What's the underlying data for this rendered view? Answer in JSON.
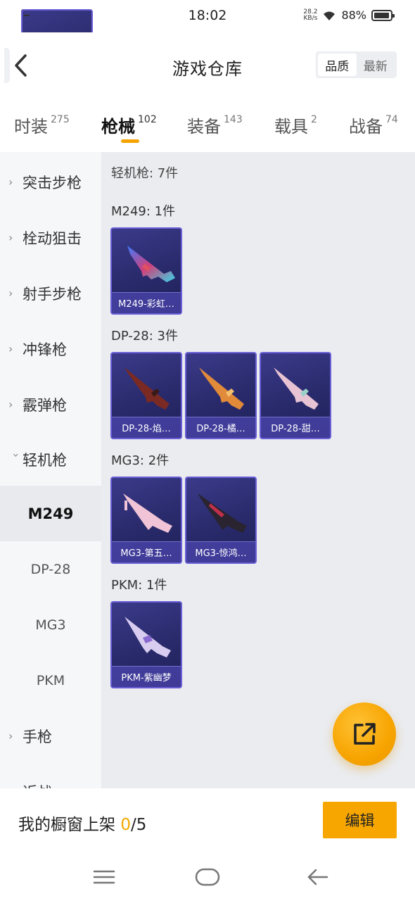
{
  "status_bar": {
    "time": "18:02",
    "net_speed_value": "28.2",
    "net_speed_unit": "KB/s",
    "battery": "88%",
    "icons": [
      "notification-x-icon",
      "app-red-icon",
      "sd-card-icon",
      "wifi-icon",
      "battery-icon"
    ]
  },
  "header": {
    "title": "游戏仓库",
    "back_icon": "back-arrow-icon",
    "sort_options": [
      "品质",
      "最新"
    ],
    "active_sort": "品质"
  },
  "tabs": [
    {
      "label": "时装",
      "count": "275"
    },
    {
      "label": "枪械",
      "count": "102",
      "active": true
    },
    {
      "label": "装备",
      "count": "143"
    },
    {
      "label": "载具",
      "count": "2"
    },
    {
      "label": "战备",
      "count": "74"
    }
  ],
  "sidebar": {
    "items": [
      {
        "label": "突击步枪",
        "type": "category",
        "expanded": false
      },
      {
        "label": "栓动狙击",
        "type": "category",
        "expanded": false
      },
      {
        "label": "射手步枪",
        "type": "category",
        "expanded": false
      },
      {
        "label": "冲锋枪",
        "type": "category",
        "expanded": false
      },
      {
        "label": "霰弹枪",
        "type": "category",
        "expanded": false
      },
      {
        "label": "轻机枪",
        "type": "category",
        "expanded": true
      },
      {
        "label": "M249",
        "type": "sub",
        "selected": true
      },
      {
        "label": "DP-28",
        "type": "sub"
      },
      {
        "label": "MG3",
        "type": "sub"
      },
      {
        "label": "PKM",
        "type": "sub"
      },
      {
        "label": "手枪",
        "type": "category",
        "expanded": false
      },
      {
        "label": "近战",
        "type": "category",
        "expanded": false
      }
    ]
  },
  "main": {
    "summary": "轻机枪: 7件",
    "groups": [
      {
        "title": "M249: 1件",
        "items": [
          {
            "label": "M249-彩虹…"
          }
        ]
      },
      {
        "title": "DP-28: 3件",
        "items": [
          {
            "label": "DP-28-焰…"
          },
          {
            "label": "DP-28-橘…"
          },
          {
            "label": "DP-28-甜…"
          }
        ]
      },
      {
        "title": "MG3: 2件",
        "items": [
          {
            "label": "MG3-第五…"
          },
          {
            "label": "MG3-惊鸿…"
          }
        ]
      },
      {
        "title": "PKM: 1件",
        "items": [
          {
            "label": "PKM-紫幽梦"
          }
        ]
      }
    ]
  },
  "fab": {
    "icon": "share-external-icon"
  },
  "bottom_bar": {
    "label": "我的橱窗上架 ",
    "count_current": "0",
    "count_total": "/5",
    "edit_label": "编辑"
  },
  "navbar": {
    "icons": [
      "menu-icon",
      "home-icon",
      "back-icon"
    ]
  },
  "colors": {
    "accent": "#f7a600",
    "card_bg": "#2c2d70",
    "card_border": "#6a5fd6"
  }
}
